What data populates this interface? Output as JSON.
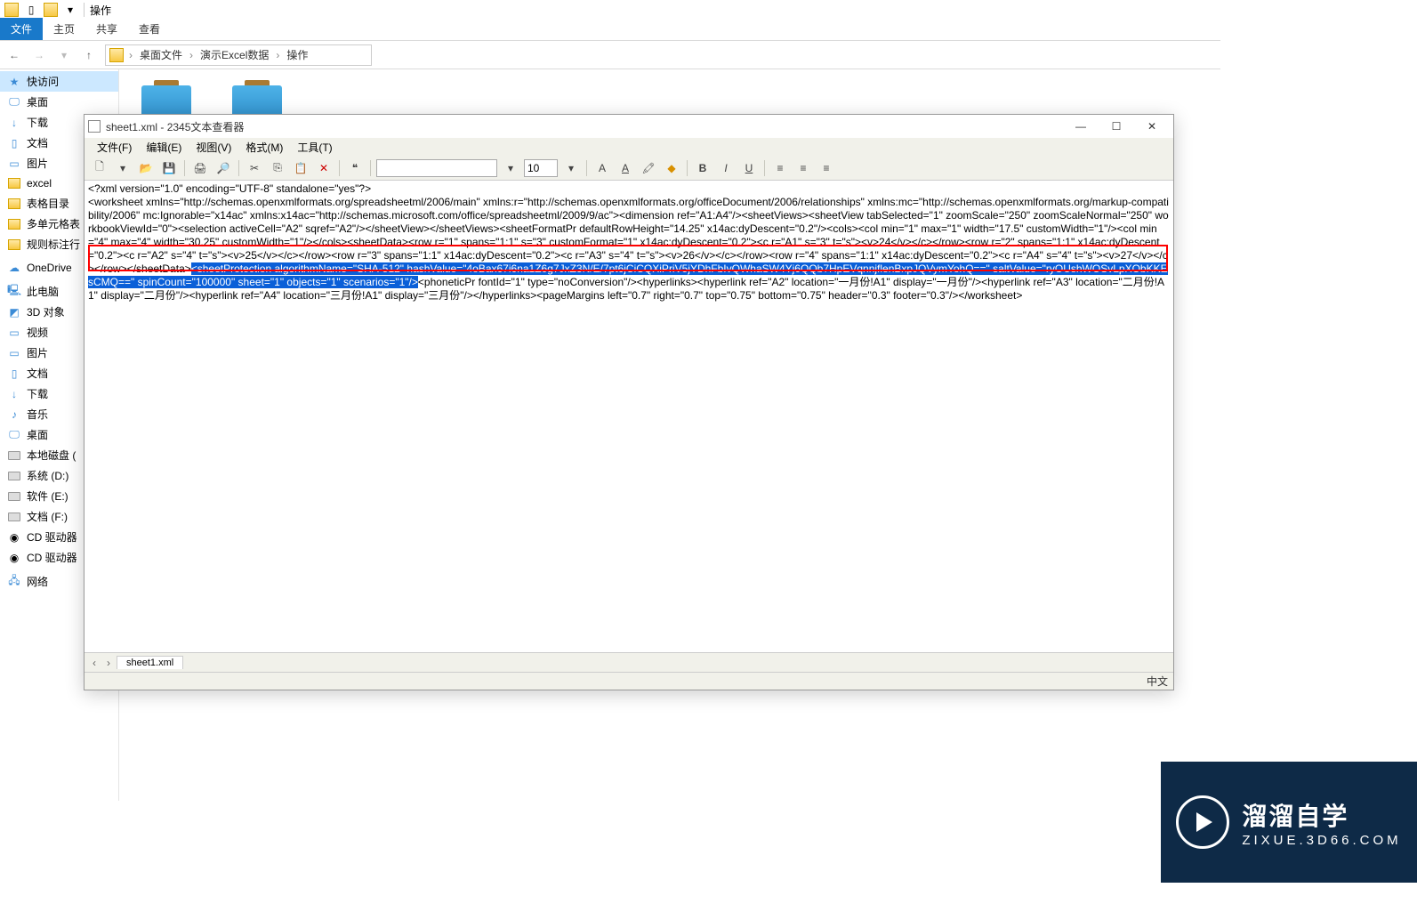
{
  "explorer": {
    "title": "操作",
    "tabs": {
      "file": "文件",
      "home": "主页",
      "share": "共享",
      "view": "查看"
    },
    "breadcrumb": {
      "seg1": "桌面文件",
      "seg2": "演示Excel数据",
      "seg3": "操作"
    }
  },
  "sidebar": {
    "quick": "快访问",
    "items1": [
      "桌面",
      "下载",
      "文档",
      "图片",
      "excel",
      "表格目录",
      "多单元格表",
      "规则标注行"
    ],
    "onedrive": "OneDrive",
    "thispc": "此电脑",
    "items2": [
      "3D 对象",
      "视频",
      "图片",
      "文档",
      "下载",
      "音乐",
      "桌面",
      "本地磁盘 (",
      "系统 (D:)",
      "软件 (E:)",
      "文档 (F:)",
      "CD 驱动器",
      "CD 驱动器"
    ],
    "network": "网络"
  },
  "viewer": {
    "title": "sheet1.xml - 2345文本查看器",
    "menus": {
      "file": "文件(F)",
      "edit": "编辑(E)",
      "view": "视图(V)",
      "format": "格式(M)",
      "tool": "工具(T)"
    },
    "font_size": "10",
    "tab_label": "sheet1.xml",
    "status": "中文",
    "content": {
      "l1": "<?xml version=\"1.0\" encoding=\"UTF-8\" standalone=\"yes\"?>",
      "l2": "<worksheet xmlns=\"http://schemas.openxmlformats.org/spreadsheetml/2006/main\" xmlns:r=\"http://schemas.openxmlformats.org/officeDocument/2006/relationships\" xmlns:mc=\"http://schemas.openxmlformats.org/markup-compatibility/2006\" mc:Ignorable=\"x14ac\" xmlns:x14ac=\"http://schemas.microsoft.com/office/spreadsheetml/2009/9/ac\"><dimension ref=\"A1:A4\"/><sheetViews><sheetView tabSelected=\"1\" zoomScale=\"250\" zoomScaleNormal=\"250\" workbookViewId=\"0\"><selection activeCell=\"A2\" sqref=\"A2\"/></sheetView></sheetViews><sheetFormatPr defaultRowHeight=\"14.25\" x14ac:dyDescent=\"0.2\"/><cols><col min=\"1\" max=\"1\" width=\"17.5\" customWidth=\"1\"/><col min=\"4\" max=\"4\" width=\"30.25\" customWidth=\"1\"/></cols><sheetData><row r=\"1\" spans=\"1:1\" s=\"3\" customFormat=\"1\" x14ac:dyDescent=\"0.2\"><c r=\"A1\" s=\"3\" t=\"s\"><v>24</v></c></row><row r=\"2\" spans=\"1:1\" x14ac:dyDescent=\"0.2\"><c r=\"A2\" s=\"4\" t=\"s\"><v>25</v></c></row><row r=\"3\" spans=\"1:1\" x14ac:dyDescent=\"0.2\"><c r=\"A3\" s=\"4\" t=\"s\"><v>26</v></c></row><row r=\"4\" spans=\"1:1\" x14ac:dyDescent=\"0.2\"><c r=\"A4\" s=\"4\" t=\"s\"><v>27</v></c></row></sheetData>",
      "hl": "<sheetProtection algorithmName=\"SHA-512\" hashValue=\"4oBax67i6na1Z6g7JxZ3N/E/7pt6jCiCQXiPriV5jYDhFbIvQWhaSW4Yj6QQb7HpEVqnnjflenBxpJQVymYohQ==\" saltValue=\"ryOUshWOSvLpXObKKEsCMQ==\" spinCount=\"100000\" sheet=\"1\" objects=\"1\" scenarios=\"1\"/>",
      "l3": "<phoneticPr fontId=\"1\" type=\"noConversion\"/><hyperlinks><hyperlink ref=\"A2\" location=\"一月份!A1\" display=\"一月份\"/><hyperlink ref=\"A3\" location=\"二月份!A1\" display=\"二月份\"/><hyperlink ref=\"A4\" location=\"三月份!A1\" display=\"三月份\"/></hyperlinks><pageMargins left=\"0.7\" right=\"0.7\" top=\"0.75\" bottom=\"0.75\" header=\"0.3\" footer=\"0.3\"/></worksheet>"
    }
  },
  "watermark": {
    "main": "溜溜自学",
    "sub": "ZIXUE.3D66.COM"
  }
}
